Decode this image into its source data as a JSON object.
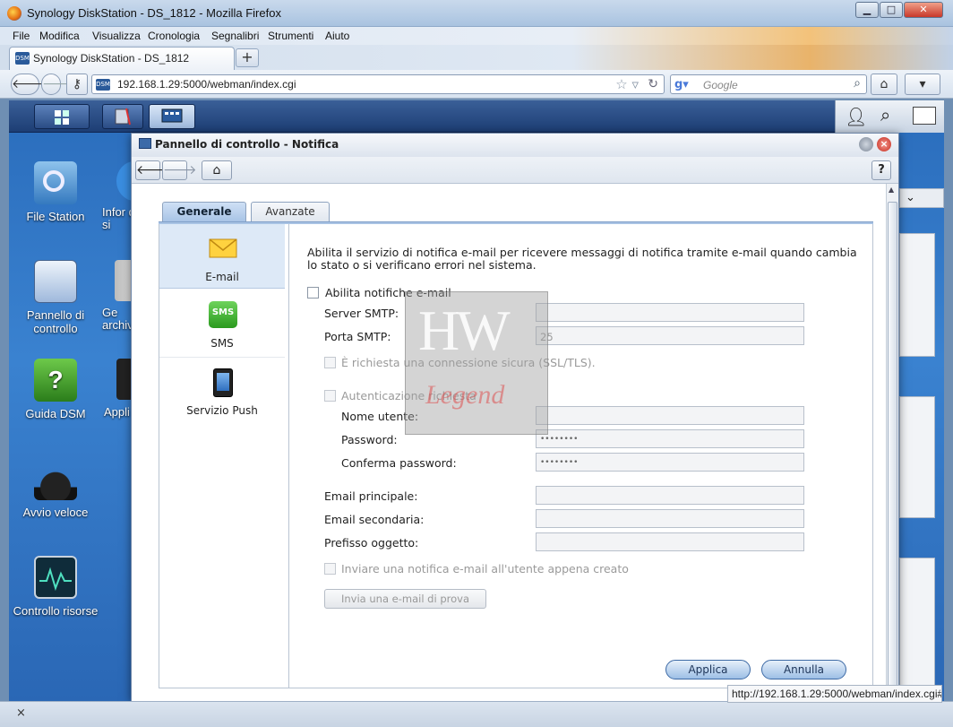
{
  "browser": {
    "window_title": "Synology DiskStation - DS_1812 - Mozilla Firefox",
    "menu": [
      "File",
      "Modifica",
      "Visualizza",
      "Cronologia",
      "Segnalibri",
      "Strumenti",
      "Aiuto"
    ],
    "tab_label": "Synology DiskStation - DS_1812",
    "favicon_text": "DSM",
    "url": "192.168.1.29:5000/webman/index.cgi",
    "search_placeholder": "Google",
    "status_url": "http://192.168.1.29:5000/webman/index.cgi#",
    "status_close": "×"
  },
  "desktop": {
    "icons": [
      {
        "label": "File Station"
      },
      {
        "label": "Pannello di controllo"
      },
      {
        "label": "Guida DSM"
      },
      {
        "label": "Avvio veloce"
      },
      {
        "label": "Controllo risorse"
      }
    ],
    "partial_icons": [
      {
        "label": "Infor di si"
      },
      {
        "label": "Ge archivi"
      },
      {
        "label": "Appli"
      }
    ]
  },
  "window": {
    "title": "Pannello di controllo - Notifica",
    "help": "?"
  },
  "tabs": [
    {
      "label": "Generale",
      "active": true
    },
    {
      "label": "Avanzate",
      "active": false
    }
  ],
  "sidebar": [
    {
      "label": "E-mail",
      "icon": "envelope-icon",
      "selected": true
    },
    {
      "label": "SMS",
      "icon": "sms-icon",
      "badge": "SMS",
      "selected": false
    },
    {
      "label": "Servizio Push",
      "icon": "smartphone-icon",
      "selected": false
    }
  ],
  "form": {
    "intro": "Abilita il servizio di notifica e-mail per ricevere messaggi di notifica tramite e-mail quando cambia lo stato o si verificano errori nel sistema.",
    "enable_label": "Abilita notifiche e-mail",
    "smtp_server_label": "Server SMTP:",
    "smtp_server_value": "",
    "smtp_port_label": "Porta SMTP:",
    "smtp_port_value": "25",
    "ssl_label": "È richiesta una connessione sicura (SSL/TLS).",
    "auth_label": "Autenticazione richiesta",
    "username_label": "Nome utente:",
    "username_value": "",
    "password_label": "Password:",
    "password_value": "••••••••",
    "confirm_label": "Conferma password:",
    "confirm_value": "••••••••",
    "primary_email_label": "Email principale:",
    "secondary_email_label": "Email secondaria:",
    "subject_prefix_label": "Prefisso oggetto:",
    "new_user_notify_label": "Inviare una notifica e-mail all'utente appena creato",
    "test_button": "Invia una e-mail di prova",
    "apply_button": "Applica",
    "cancel_button": "Annulla"
  },
  "watermark": {
    "line1": "HW",
    "line2": "Legend"
  }
}
